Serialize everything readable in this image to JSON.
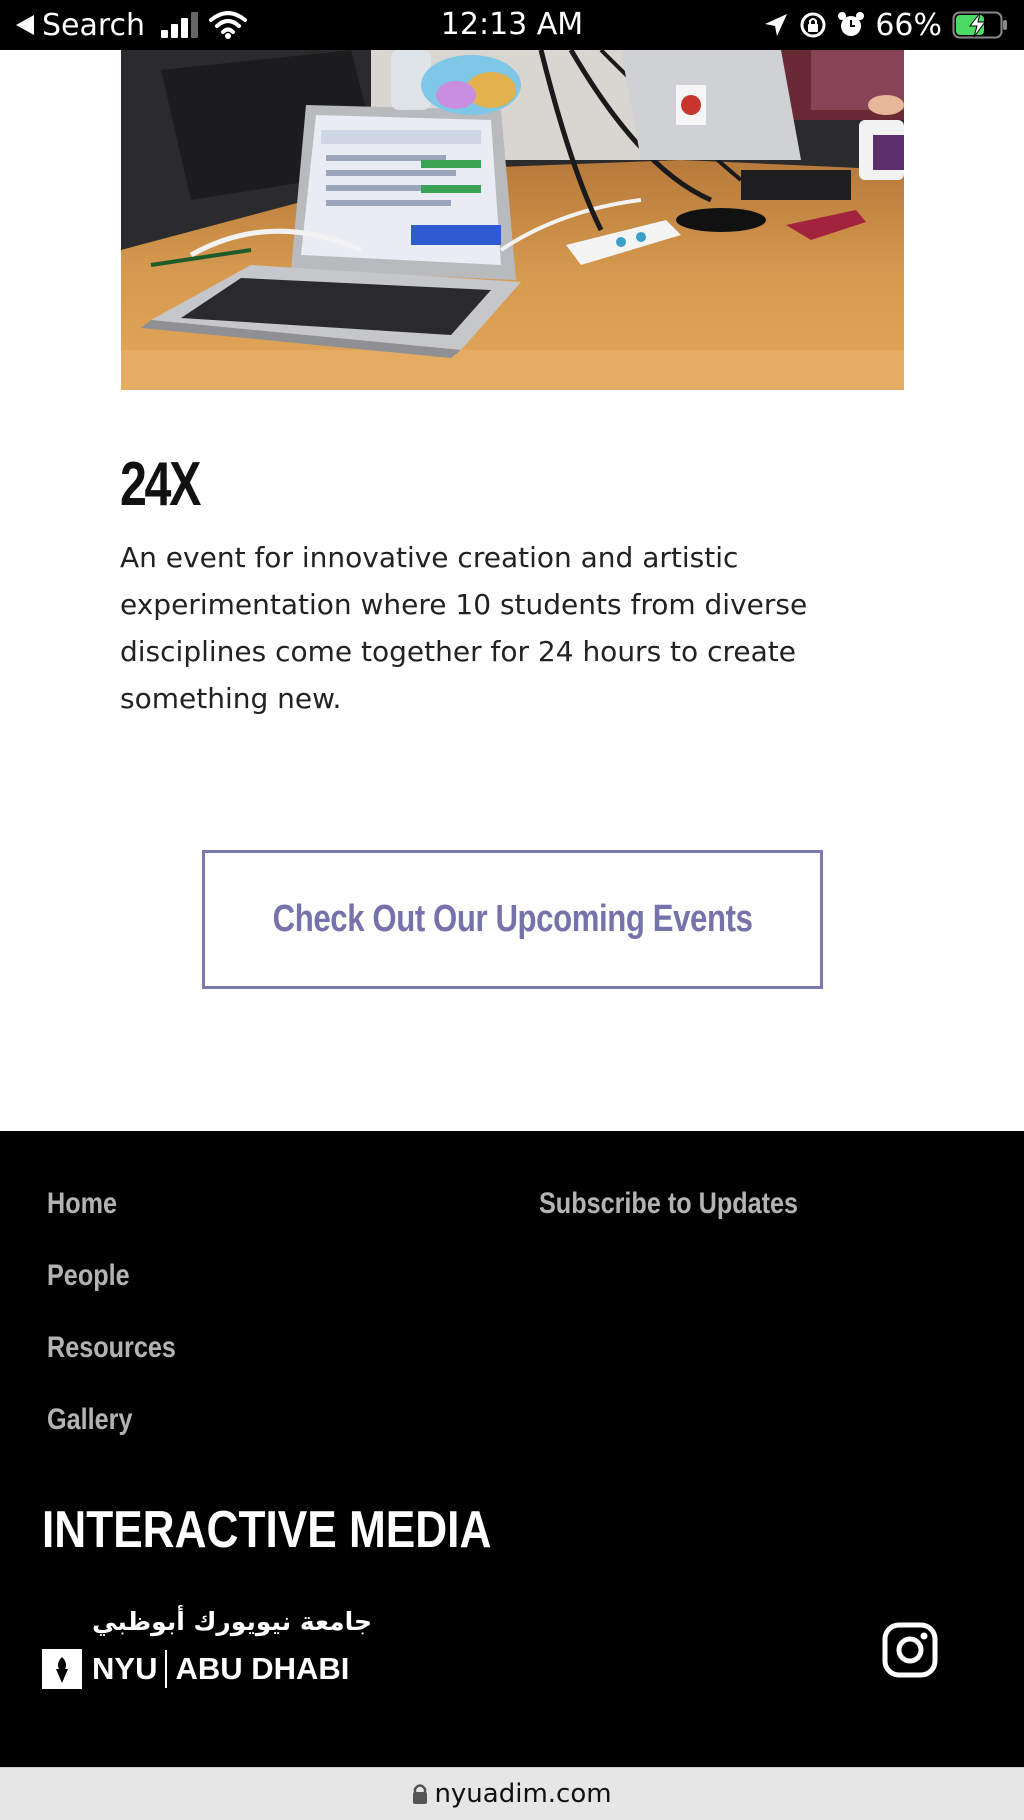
{
  "status_bar": {
    "back_label": "Search",
    "time": "12:13 AM",
    "battery_percent": "66%",
    "battery_level": 0.66,
    "icons": [
      "back-arrow-icon",
      "signal-icon",
      "wifi-icon",
      "location-icon",
      "orientation-lock-icon",
      "alarm-icon",
      "battery-charging-icon"
    ]
  },
  "hero": {
    "image": "photo-laptops-on-table"
  },
  "event": {
    "title": "24X",
    "description": "An event for innovative creation and artistic experimentation where 10 students from diverse disciplines come together for 24 hours to create something new."
  },
  "cta": {
    "label": "Check Out Our Upcoming Events",
    "color": "#7673ac"
  },
  "footer": {
    "nav": [
      "Home",
      "People",
      "Resources",
      "Gallery"
    ],
    "subscribe": "Subscribe to Updates",
    "brand": "INTERACTIVE MEDIA",
    "university": {
      "arabic": "جامعة نيويورك أبوظبي",
      "name_left": "NYU",
      "name_right": "ABU DHABI"
    },
    "social": [
      "instagram-icon"
    ]
  },
  "browser": {
    "url": "nyuadim.com"
  }
}
